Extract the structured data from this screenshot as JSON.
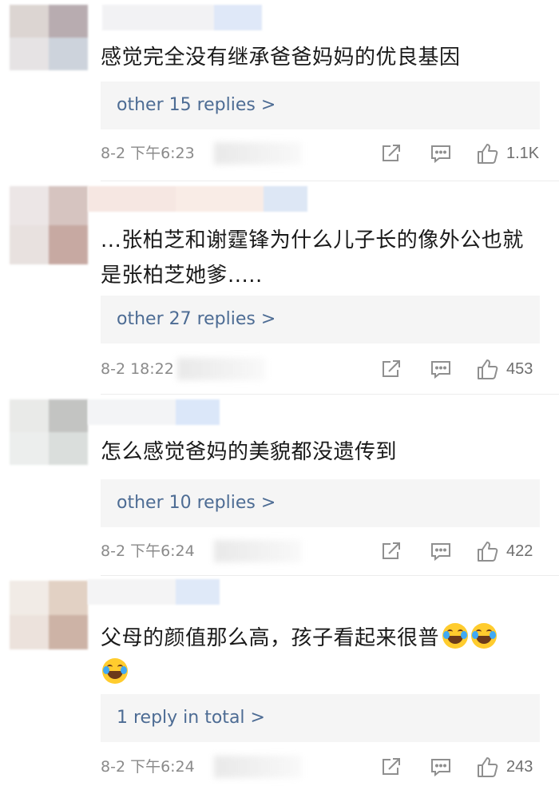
{
  "comments": [
    {
      "text": "感觉完全没有继承爸爸妈妈的优良基因",
      "replies_label": "other 15 replies >",
      "time": "8-2 下午6:23",
      "likes": "1.1K"
    },
    {
      "text": "...张柏芝和谢霆锋为什么儿子长的像外公也就是张柏芝她爹.....",
      "replies_label": "other 27 replies >",
      "time": "8-2 18:22",
      "likes": "453"
    },
    {
      "text": "怎么感觉爸妈的美貌都没遗传到",
      "replies_label": "other 10 replies >",
      "time": "8-2 下午6:24",
      "likes": "422"
    },
    {
      "text": "父母的颜值那么高，孩子看起来很普",
      "replies_label": "1 reply in total >",
      "time": "8-2 下午6:24",
      "likes": "243"
    }
  ],
  "icons": {
    "share": "share-icon",
    "reply": "comment-icon",
    "like": "thumbs-up-icon",
    "emoji": "face-with-tears-of-joy-emoji"
  },
  "colors": {
    "reply_link": "#4d6c94",
    "reply_bg": "#f5f5f5",
    "meta_text": "#8a8a8a",
    "icon_stroke": "#8f8f8f"
  }
}
